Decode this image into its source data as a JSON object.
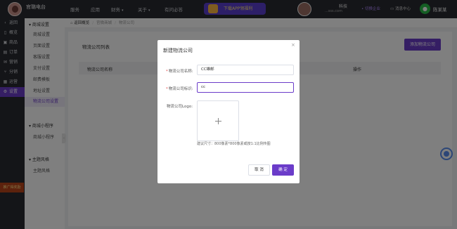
{
  "topbar": {
    "brand": "官璐电台",
    "nav": [
      "服务",
      "应用",
      "财务",
      "关于",
      "有问必答"
    ],
    "promo": "下载APP领福利",
    "shop_name": "科技",
    "shop_url": "...sss.com",
    "switch_label": "• 切换企业",
    "message_center": "消息中心",
    "user_name": "陈某某"
  },
  "sidebar": {
    "items": [
      {
        "icon": "‹",
        "label": "返回"
      },
      {
        "icon": "▯",
        "label": "概览"
      },
      {
        "icon": "▣",
        "label": "商品"
      },
      {
        "icon": "▤",
        "label": "订单"
      },
      {
        "icon": "✉",
        "label": "营销"
      },
      {
        "icon": "⑂",
        "label": "分销"
      },
      {
        "icon": "▦",
        "label": "运营"
      },
      {
        "icon": "⚙",
        "label": "设置"
      }
    ],
    "promo": "推广得奖励"
  },
  "submenu": {
    "groups": [
      {
        "title": "商城设置",
        "items": [
          "商城设置",
          "页面设置",
          "客服设置",
          "支付设置",
          "邮费模板",
          "地址设置",
          "物流公司设置"
        ]
      },
      {
        "title": "商城小程序",
        "items": [
          "商城小程序"
        ]
      },
      {
        "title": "主题风格",
        "items": [
          "主题风格"
        ]
      }
    ]
  },
  "breadcrumb": {
    "back": "返回概览",
    "level1": "官微商城",
    "level2": "物流公司"
  },
  "panel": {
    "title": "物流公司列表",
    "add_button": "添加物流公司",
    "columns": [
      "物流公司名称",
      "操作"
    ]
  },
  "modal": {
    "title": "新建物流公司",
    "close": "×",
    "name_label": "物流公司名称:",
    "name_value": "CC雄邮",
    "code_label": "物流公司标识:",
    "code_value": "cc",
    "logo_label": "物流公司Logo:",
    "logo_hint": "建议尺寸：800像素*800像素或按1:1比例传图",
    "cancel": "取 消",
    "confirm": "确 定"
  }
}
